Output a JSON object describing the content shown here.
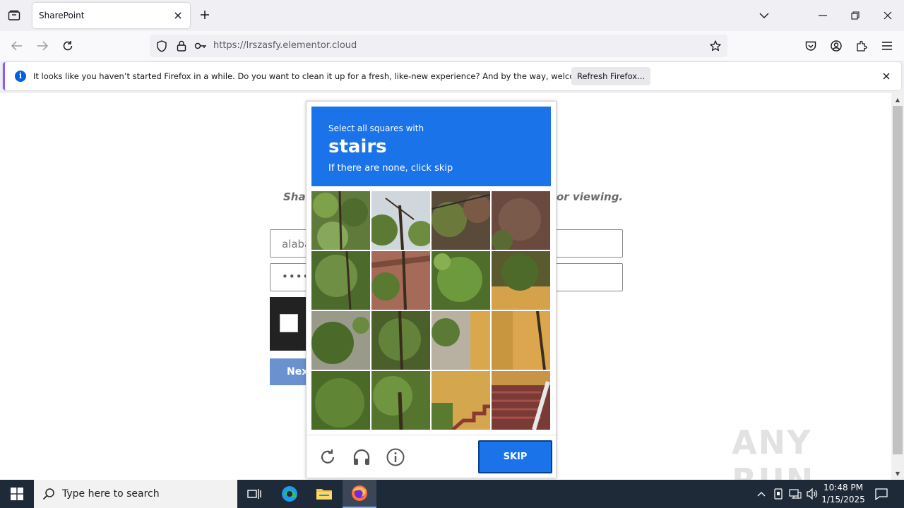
{
  "browser": {
    "tab": {
      "title": "SharePoint"
    },
    "url": "https://lrszasfy.elementor.cloud",
    "notification": {
      "text": "It looks like you haven’t started Firefox in a while. Do you want to clean it up for a fresh, like-new experience? And by the way, welcome back!",
      "button_label": "Refresh Firefox..."
    }
  },
  "page": {
    "message_left": "Shar",
    "message_right": "or viewing.",
    "email_value": "alaba",
    "password_value": "••••",
    "next_label": "Nex"
  },
  "challenge": {
    "instruction": "Select all squares with",
    "target_word": "stairs",
    "hint": "If there are none, click skip",
    "skip_label": "SKIP"
  },
  "watermark": "ANY RUN",
  "taskbar": {
    "search_placeholder": "Type here to search",
    "time": "10:48 PM",
    "date": "1/15/2025"
  },
  "colors": {
    "challenge_accent": "#1a73e8",
    "taskbar_bg": "#1f2a38",
    "firefox_accent": "#9059ff"
  }
}
